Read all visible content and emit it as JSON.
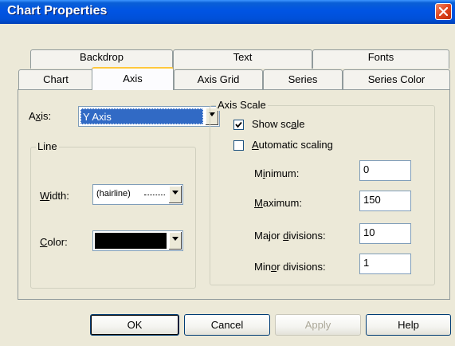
{
  "window": {
    "title": "Chart Properties"
  },
  "tabs": {
    "row1": [
      "Backdrop",
      "Text",
      "Fonts"
    ],
    "row2": [
      "Chart",
      "Axis",
      "Axis Grid",
      "Series",
      "Series Color"
    ],
    "active": "Axis"
  },
  "axis": {
    "label": "Axis:",
    "value": "Y Axis"
  },
  "line": {
    "title": "Line",
    "width_label": "Width:",
    "width_value": "(hairline)",
    "color_label": "Color:",
    "color_value": "#000000"
  },
  "scale": {
    "title": "Axis Scale",
    "show_scale": {
      "label": "Show scale",
      "checked": true
    },
    "automatic_scaling": {
      "label": "Automatic scaling",
      "checked": false
    },
    "minimum": {
      "label": "Minimum:",
      "value": "0"
    },
    "maximum": {
      "label": "Maximum:",
      "value": "150"
    },
    "major_divisions": {
      "label": "Major divisions:",
      "value": "10"
    },
    "minor_divisions": {
      "label": "Minor divisions:",
      "value": "1"
    }
  },
  "buttons": {
    "ok": "OK",
    "cancel": "Cancel",
    "apply": "Apply",
    "help": "Help"
  },
  "colors": {
    "titlebar": "#0054e3",
    "selection": "#316ac5",
    "active_tab_accent": "#ffc83c"
  }
}
